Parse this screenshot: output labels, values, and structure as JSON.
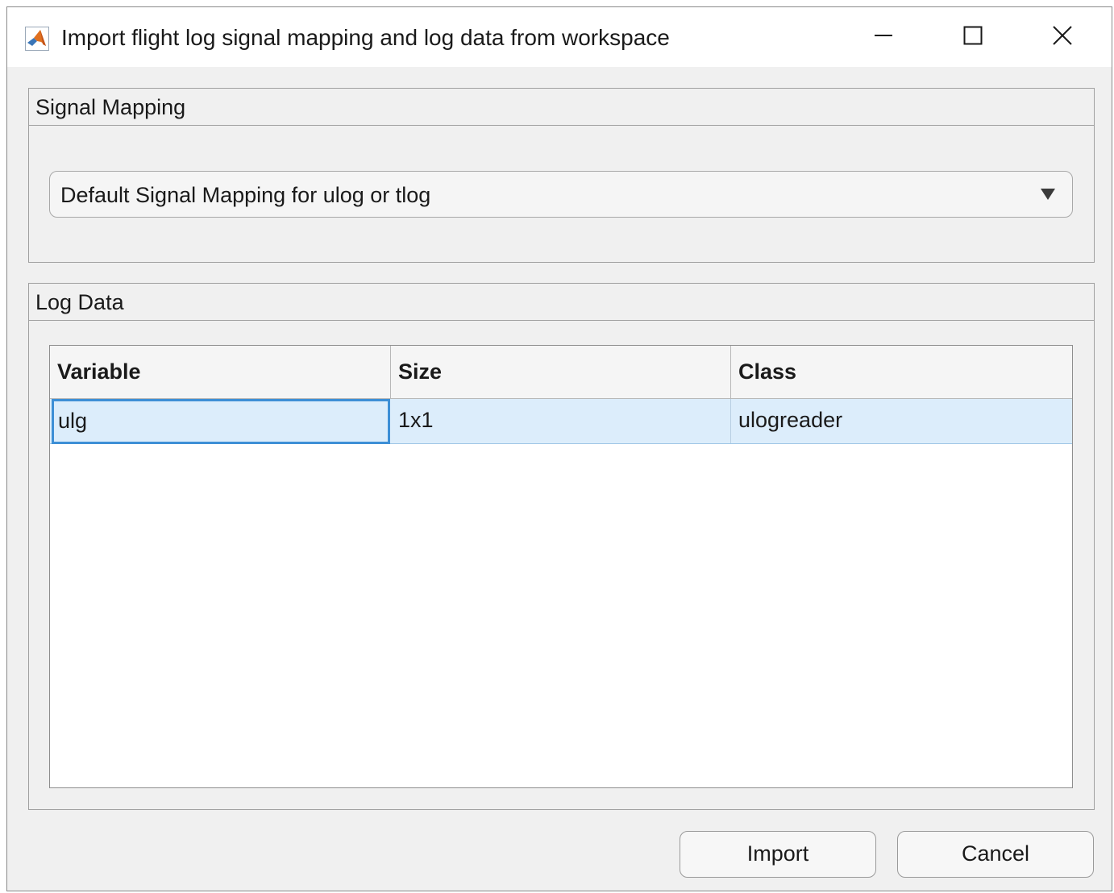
{
  "window": {
    "title": "Import flight log signal mapping and log data from workspace",
    "app_icon": "matlab-logo-icon",
    "controls": [
      "minimize-icon",
      "maximize-icon",
      "close-icon"
    ]
  },
  "signal_mapping": {
    "title": "Signal Mapping",
    "dropdown": {
      "selected": "Default Signal Mapping for ulog or tlog",
      "icon": "dropdown-arrow-icon"
    }
  },
  "log_data": {
    "title": "Log Data",
    "table": {
      "headers": [
        "Variable",
        "Size",
        "Class"
      ],
      "rows": [
        {
          "variable": "ulg",
          "size": "1x1",
          "class": "ulogreader"
        }
      ]
    }
  },
  "buttons": {
    "import": "Import",
    "cancel": "Cancel"
  },
  "colors": {
    "selected_row": "#dcedfb",
    "focus_border": "#3d8fd6",
    "window_bg": "#f0f0f0"
  }
}
